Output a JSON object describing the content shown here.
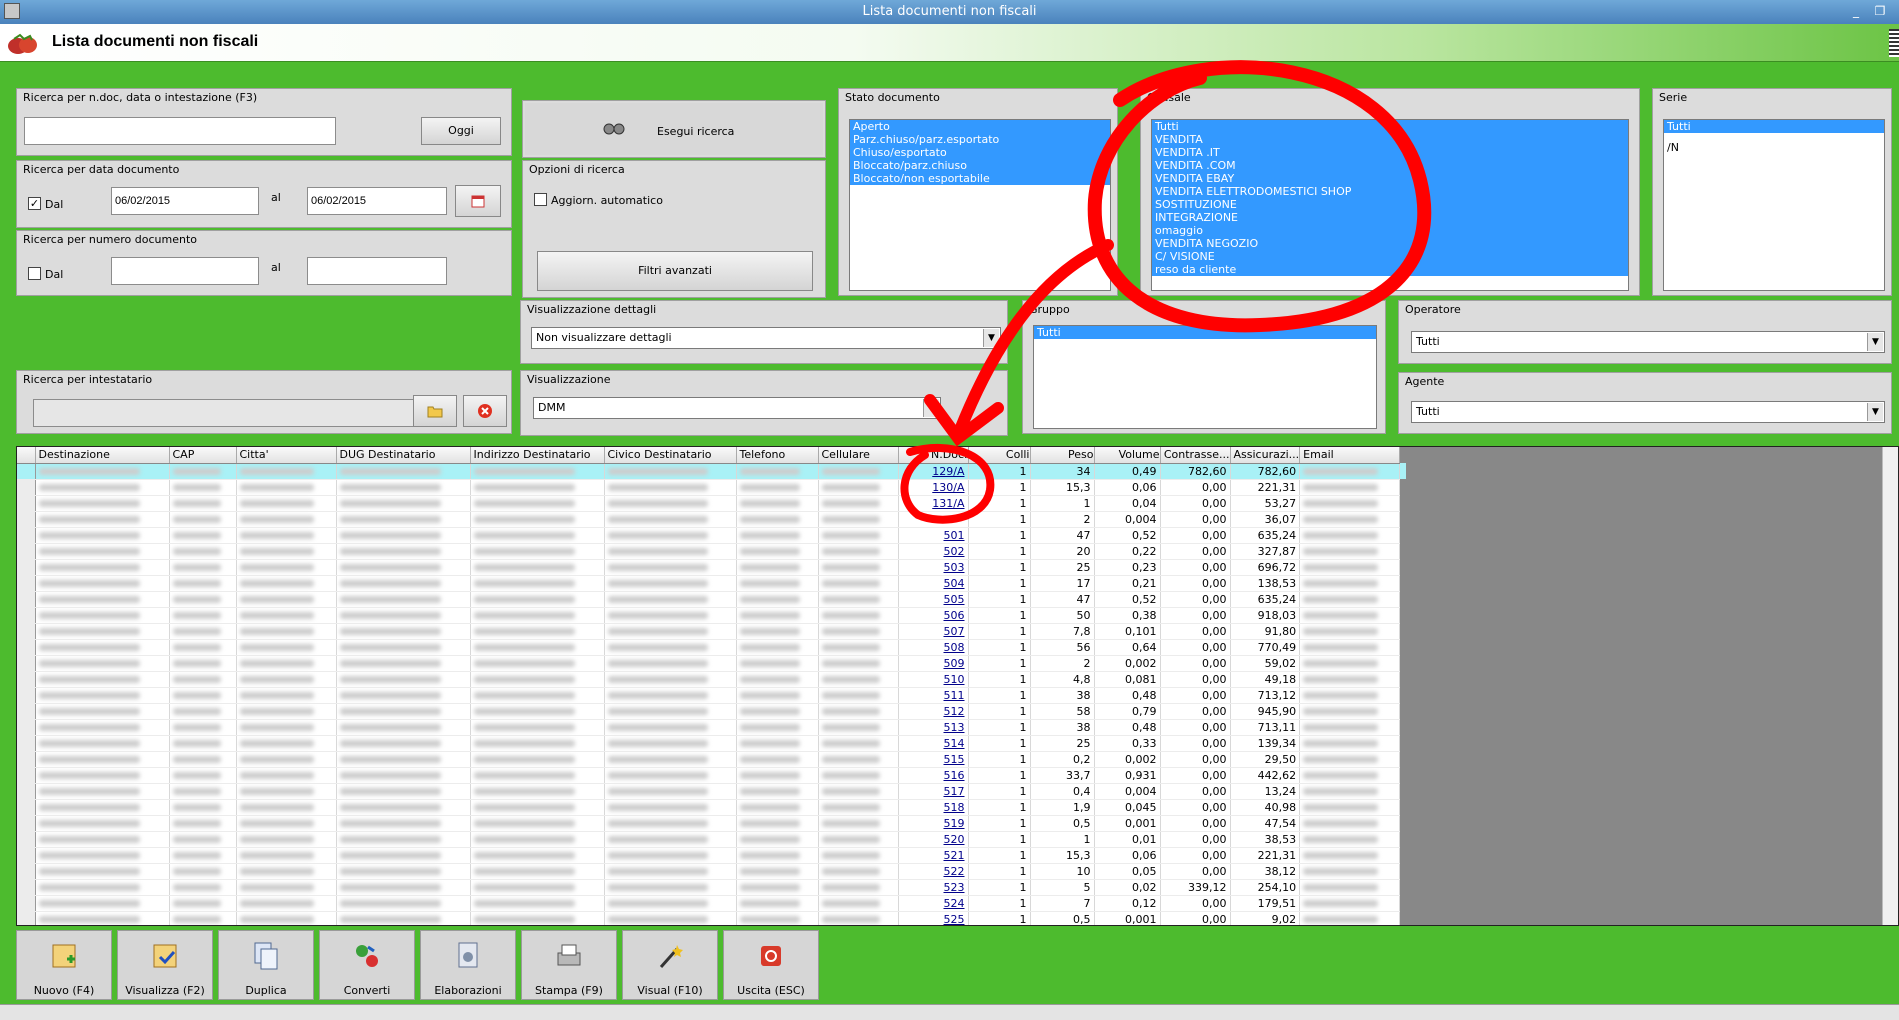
{
  "window": {
    "title": "Lista documenti non fiscali"
  },
  "header": {
    "title": "Lista documenti non fiscali"
  },
  "search_text": {
    "label": "Ricerca per n.doc, data o intestazione (F3)",
    "value": "",
    "today_button": "Oggi"
  },
  "date_search": {
    "label": "Ricerca per data documento",
    "from_checked": true,
    "from_label": "Dal",
    "from_value": "06/02/2015",
    "to_label": "al",
    "to_value": "06/02/2015"
  },
  "number_search": {
    "label": "Ricerca per numero documento",
    "from_checked": false,
    "from_label": "Dal",
    "from_value": "",
    "to_label": "al",
    "to_value": ""
  },
  "execute": {
    "label": "Esegui ricerca"
  },
  "options": {
    "label": "Opzioni di ricerca",
    "auto_update_label": "Aggiorn. automatico",
    "auto_update_checked": false,
    "advanced_label": "Filtri avanzati"
  },
  "stato": {
    "label": "Stato documento",
    "items": [
      "Aperto",
      "Parz.chiuso/parz.esportato",
      "Chiuso/esportato",
      "Bloccato/parz.chiuso",
      "Bloccato/non esportabile"
    ]
  },
  "causale": {
    "label": "Causale",
    "items": [
      "Tutti",
      "VENDITA",
      "VENDITA .IT",
      "VENDITA .COM",
      "VENDITA EBAY",
      "VENDITA ELETTRODOMESTICI SHOP",
      "SOSTITUZIONE",
      "INTEGRAZIONE",
      "omaggio",
      "VENDITA NEGOZIO",
      "C/ VISIONE",
      "reso da cliente"
    ]
  },
  "serie": {
    "label": "Serie",
    "items": [
      "Tutti",
      "/N"
    ]
  },
  "dettagli": {
    "label": "Visualizzazione dettagli",
    "value": "Non visualizzare dettagli"
  },
  "visualizzazione": {
    "label": "Visualizzazione",
    "value": "DMM"
  },
  "gruppo": {
    "label": "Gruppo",
    "items": [
      "Tutti"
    ]
  },
  "operatore": {
    "label": "Operatore",
    "value": "Tutti"
  },
  "agente": {
    "label": "Agente",
    "value": "Tutti"
  },
  "intestatario": {
    "label": "Ricerca per intestatario",
    "value": ""
  },
  "grid": {
    "columns": [
      "Destinazione",
      "CAP",
      "Citta'",
      "DUG Destinatario",
      "Indirizzo Destinatario",
      "Civico Destinatario",
      "Telefono",
      "Cellulare",
      "N.Doc.",
      "Colli",
      "Peso",
      "Volume",
      "Contrasse...",
      "Assicurazi...",
      "Email"
    ],
    "rows": [
      [
        "129/A",
        "1",
        "34",
        "0,49",
        "782,60",
        "782,60"
      ],
      [
        "130/A",
        "1",
        "15,3",
        "0,06",
        "0,00",
        "221,31"
      ],
      [
        "131/A",
        "1",
        "1",
        "0,04",
        "0,00",
        "53,27"
      ],
      [
        "",
        "1",
        "2",
        "0,004",
        "0,00",
        "36,07"
      ],
      [
        "501",
        "1",
        "47",
        "0,52",
        "0,00",
        "635,24"
      ],
      [
        "502",
        "1",
        "20",
        "0,22",
        "0,00",
        "327,87"
      ],
      [
        "503",
        "1",
        "25",
        "0,23",
        "0,00",
        "696,72"
      ],
      [
        "504",
        "1",
        "17",
        "0,21",
        "0,00",
        "138,53"
      ],
      [
        "505",
        "1",
        "47",
        "0,52",
        "0,00",
        "635,24"
      ],
      [
        "506",
        "1",
        "50",
        "0,38",
        "0,00",
        "918,03"
      ],
      [
        "507",
        "1",
        "7,8",
        "0,101",
        "0,00",
        "91,80"
      ],
      [
        "508",
        "1",
        "56",
        "0,64",
        "0,00",
        "770,49"
      ],
      [
        "509",
        "1",
        "2",
        "0,002",
        "0,00",
        "59,02"
      ],
      [
        "510",
        "1",
        "4,8",
        "0,081",
        "0,00",
        "49,18"
      ],
      [
        "511",
        "1",
        "38",
        "0,48",
        "0,00",
        "713,12"
      ],
      [
        "512",
        "1",
        "58",
        "0,79",
        "0,00",
        "945,90"
      ],
      [
        "513",
        "1",
        "38",
        "0,48",
        "0,00",
        "713,11"
      ],
      [
        "514",
        "1",
        "25",
        "0,33",
        "0,00",
        "139,34"
      ],
      [
        "515",
        "1",
        "0,2",
        "0,002",
        "0,00",
        "29,50"
      ],
      [
        "516",
        "1",
        "33,7",
        "0,931",
        "0,00",
        "442,62"
      ],
      [
        "517",
        "1",
        "0,4",
        "0,004",
        "0,00",
        "13,24"
      ],
      [
        "518",
        "1",
        "1,9",
        "0,045",
        "0,00",
        "40,98"
      ],
      [
        "519",
        "1",
        "0,5",
        "0,001",
        "0,00",
        "47,54"
      ],
      [
        "520",
        "1",
        "1",
        "0,01",
        "0,00",
        "38,53"
      ],
      [
        "521",
        "1",
        "15,3",
        "0,06",
        "0,00",
        "221,31"
      ],
      [
        "522",
        "1",
        "10",
        "0,05",
        "0,00",
        "38,12"
      ],
      [
        "523",
        "1",
        "5",
        "0,02",
        "339,12",
        "254,10"
      ],
      [
        "524",
        "1",
        "7",
        "0,12",
        "0,00",
        "179,51"
      ],
      [
        "525",
        "1",
        "0,5",
        "0,001",
        "0,00",
        "9,02"
      ]
    ]
  },
  "toolbar": {
    "buttons": [
      {
        "label": "Nuovo (F4)",
        "icon": "new-document-icon"
      },
      {
        "label": "Visualizza (F2)",
        "icon": "view-document-icon"
      },
      {
        "label": "Duplica",
        "icon": "duplicate-icon"
      },
      {
        "label": "Converti",
        "icon": "convert-icon"
      },
      {
        "label": "Elaborazioni",
        "icon": "process-icon"
      },
      {
        "label": "Stampa (F9)",
        "icon": "printer-icon"
      },
      {
        "label": "Visual (F10)",
        "icon": "magic-wand-icon"
      },
      {
        "label": "Uscita (ESC)",
        "icon": "exit-icon"
      }
    ]
  },
  "colors": {
    "accent_green": "#4dbb2e",
    "selection_blue": "#3399ff",
    "annotation_red": "#ff0000",
    "selected_row": "#a9f1f6"
  }
}
